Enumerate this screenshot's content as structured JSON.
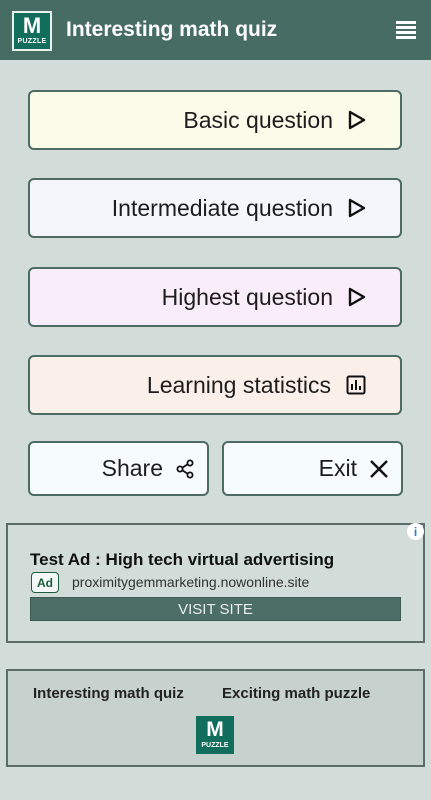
{
  "appbar": {
    "logo_letter": "M",
    "logo_sub": "PUZZLE",
    "title": "Interesting math quiz",
    "menu_icon": "hamburger-menu-icon"
  },
  "menu": {
    "basic_label": "Basic question",
    "intermediate_label": "Intermediate question",
    "highest_label": "Highest question",
    "stats_label": "Learning statistics",
    "share_label": "Share",
    "exit_label": "Exit",
    "icons": {
      "play": "play-arrow-icon",
      "stats": "bar-chart-icon",
      "share": "share-icon",
      "exit": "close-icon"
    }
  },
  "ad": {
    "title": "Test Ad : High tech virtual advertising",
    "badge": "Ad",
    "url": "proximitygemmarketing.nowonline.site",
    "cta": "VISIT SITE",
    "info_icon": "info-icon"
  },
  "footer": {
    "link1": "Interesting math quiz",
    "link2": "Exciting math puzzle",
    "logo_letter": "M",
    "logo_sub": "PUZZLE"
  },
  "colors": {
    "appbar": "#466c64",
    "background": "#d2dcd9",
    "button_border": "#4b6b63",
    "logo_bg": "#126e5c"
  }
}
